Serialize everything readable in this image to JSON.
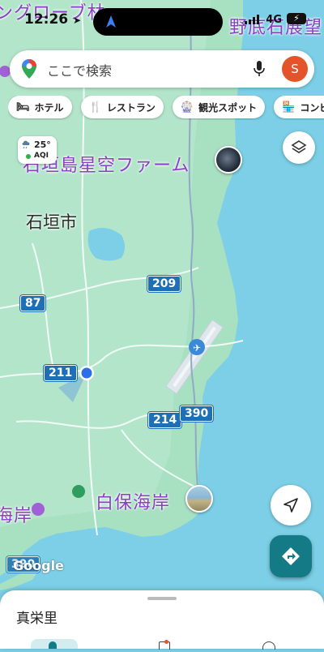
{
  "status_bar": {
    "time": "12:26",
    "network": "4G"
  },
  "search": {
    "placeholder": "ここで検索",
    "avatar_letter": "S"
  },
  "chips": [
    {
      "label": "ホテル",
      "icon": "bed-icon"
    },
    {
      "label": "レストラン",
      "icon": "fork-knife-icon"
    },
    {
      "label": "観光スポット",
      "icon": "ferris-wheel-icon"
    },
    {
      "label": "コンビニ",
      "icon": "store-icon"
    }
  ],
  "weather": {
    "temperature": "25°",
    "aqi_label": "AQI"
  },
  "map": {
    "labels": {
      "top_left_partial": "ングローブ林",
      "top_right_partial": "野底石展望",
      "farm": "石垣島星空ファーム",
      "city": "石垣市",
      "beach": "白保海岸",
      "left_partial": "海岸"
    },
    "routes": [
      "209",
      "87",
      "211",
      "214",
      "390",
      "390"
    ],
    "attribution": "Google"
  },
  "sheet": {
    "title": "真栄里"
  },
  "colors": {
    "sea": "#7ccfe6",
    "land": "#a8e0c2",
    "accent": "#137a86",
    "label_purple": "#8a3fc4"
  }
}
